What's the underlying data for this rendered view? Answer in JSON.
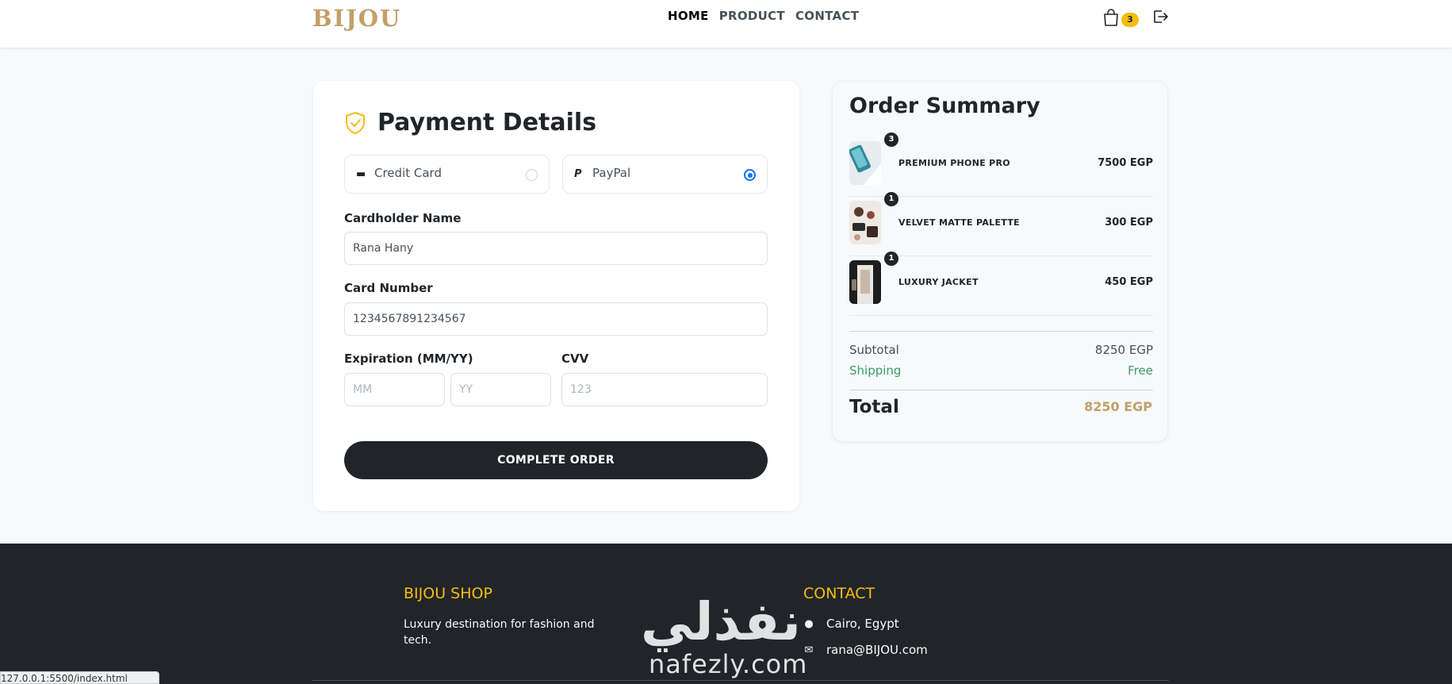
{
  "header": {
    "logo": "BIJOU",
    "nav": [
      "HOME",
      "PRODUCT",
      "CONTACT"
    ],
    "cart_count": "3"
  },
  "payment": {
    "title": "Payment Details",
    "methods": [
      {
        "label": "Credit Card",
        "selected": false
      },
      {
        "label": "PayPal",
        "selected": true
      }
    ],
    "cardholder_label": "Cardholder Name",
    "cardholder_value": "Rana Hany",
    "card_number_label": "Card Number",
    "card_number_value": "1234567891234567",
    "expiration_label": "Expiration (MM/YY)",
    "mm_placeholder": "MM",
    "yy_placeholder": "YY",
    "cvv_label": "CVV",
    "cvv_placeholder": "123",
    "submit_label": "COMPLETE ORDER"
  },
  "summary": {
    "title": "Order Summary",
    "items": [
      {
        "name": "PREMIUM PHONE PRO",
        "price": "7500 EGP",
        "qty": "3"
      },
      {
        "name": "VELVET MATTE PALETTE",
        "price": "300 EGP",
        "qty": "1"
      },
      {
        "name": "LUXURY JACKET",
        "price": "450 EGP",
        "qty": "1"
      }
    ],
    "subtotal_label": "Subtotal",
    "subtotal_value": "8250 EGP",
    "shipping_label": "Shipping",
    "shipping_value": "Free",
    "total_label": "Total",
    "total_value": "8250 EGP"
  },
  "footer": {
    "shop_title": "BIJOU SHOP",
    "shop_desc": "Luxury destination for fashion and tech.",
    "contact_title": "CONTACT",
    "location": "Cairo, Egypt",
    "email": "rana@BIJOU.com"
  },
  "watermark": {
    "arabic": "نفذلي",
    "latin": "nafezly.com"
  },
  "status_url": "127.0.0.1:5500/index.html",
  "colors": {
    "brand_gold": "#c2a068",
    "accent_yellow": "#f5bd0f",
    "dark": "#212529",
    "shipping_green": "#3a9a6c",
    "radio_blue": "#0d6efd"
  }
}
